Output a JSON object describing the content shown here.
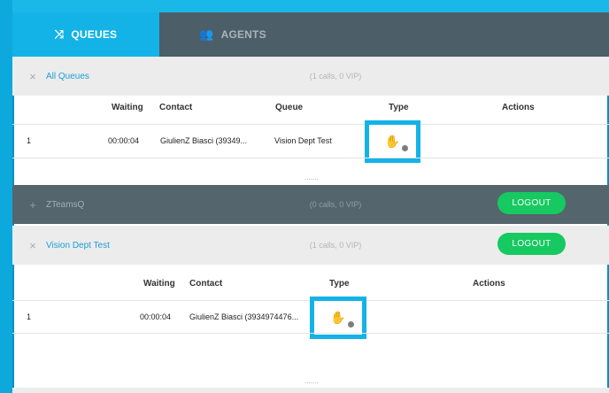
{
  "tabs": [
    {
      "label": "QUEUES",
      "icon": "shuffle-icon",
      "active": true
    },
    {
      "label": "AGENTS",
      "icon": "group-icon",
      "active": false
    }
  ],
  "queues": [
    {
      "name": "All Queues",
      "toggle": "×",
      "stats": "(1 calls, 0 VIP)",
      "columns": {
        "waiting": "Waiting",
        "contact": "Contact",
        "queue": "Queue",
        "type": "Type",
        "actions": "Actions"
      },
      "rows": [
        {
          "index": "1",
          "waiting": "00:00:04",
          "contact": "GiulienZ Biasci (39349...",
          "queue": "Vision Dept Test"
        }
      ],
      "more": "......."
    },
    {
      "name": "ZTeamsQ",
      "toggle": "+",
      "stats": "(0 calls, 0 VIP)",
      "logout": "LOGOUT"
    },
    {
      "name": "Vision Dept Test",
      "toggle": "×",
      "stats": "(1 calls, 0 VIP)",
      "logout": "LOGOUT",
      "columns": {
        "waiting": "Waiting",
        "contact": "Contact",
        "type": "Type",
        "actions": "Actions"
      },
      "rows": [
        {
          "index": "1",
          "waiting": "00:00:04",
          "contact": "GiulienZ Biasci (3934974476..."
        }
      ],
      "more": "......."
    }
  ],
  "colors": {
    "accent": "#13b3e7",
    "header": "#4c5e67",
    "logout": "#16c960"
  }
}
